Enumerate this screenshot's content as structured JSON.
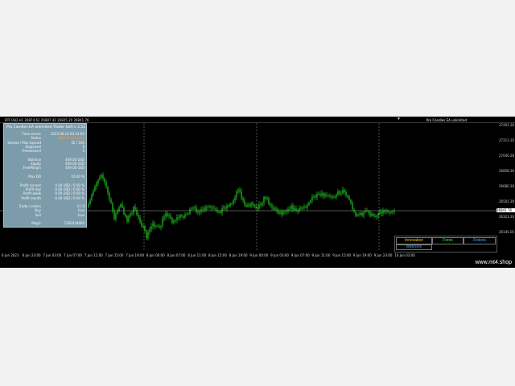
{
  "chart": {
    "symbol_info": "BTCUSD,H1  26874.62 26887.42 26825.20 26841.76",
    "ea_tag": "Pro Candles EA unlimited",
    "drop_marker": "▼",
    "price_ticks": [
      "27403.30",
      "27213.35",
      "27040.28",
      "26858.30",
      "26680.20",
      "26501.30",
      "26323.20",
      "26145.05"
    ],
    "current_price": "26841.76",
    "time_labels": [
      "6 Jun 2023",
      "6 Jun 23:00",
      "7 Jun 03:00",
      "7 Jun 07:00",
      "7 Jun 11:00",
      "7 Jun 15:00",
      "7 Jun 19:00",
      "8 Jun 00:00",
      "8 Jun 07:00",
      "8 Jun 11:00",
      "8 Jun 15:00",
      "8 Jun 19:00",
      "9 Jun 00:00",
      "9 Jun 03:00",
      "9 Jun 07:00",
      "9 Jun 11:00",
      "9 Jun 15:00",
      "9 Jun 19:00",
      "9 Jun 23:00",
      "10 Jun 03:00"
    ],
    "watermark": "www.mt4.shop",
    "colors": {
      "candle": "#22cc22",
      "background": "#000000",
      "panel": "#7d9cab",
      "warning": "#ff9a30"
    }
  },
  "panel": {
    "title": "Pro Candles EA unlimited Trader Soft v 3.52",
    "rows": [
      {
        "label": "Time server",
        "value": "2023.06.10 03:41:00",
        "warn": false
      },
      {
        "label": "Status",
        "value": "Market is closed",
        "warn": true
      },
      {
        "label": "Spread / Max Spread",
        "value": "35 / 100",
        "warn": false
      },
      {
        "label": "StopLevel",
        "value": "0",
        "warn": false
      },
      {
        "label": "FreezeLevel",
        "value": "0",
        "warn": false
      },
      {
        "label": "",
        "value": "",
        "warn": false
      },
      {
        "label": "Balance",
        "value": "449.00 USD",
        "warn": false
      },
      {
        "label": "Equity",
        "value": "449.00 USD",
        "warn": false
      },
      {
        "label": "FreeMargin",
        "value": "449.00 USD",
        "warn": false
      },
      {
        "label": "",
        "value": "",
        "warn": false
      },
      {
        "label": "Max DD",
        "value": "10.00 %",
        "warn": false
      },
      {
        "label": "",
        "value": "",
        "warn": false
      },
      {
        "label": "Profit current",
        "value": "0.00 USD / 0.00 %",
        "warn": false
      },
      {
        "label": "Profit day",
        "value": "0.00 USD / 0.00 %",
        "warn": false
      },
      {
        "label": "Profit week",
        "value": "0.00 USD / 0.00 %",
        "warn": false
      },
      {
        "label": "Profit month",
        "value": "0.00 USD / 0.00 %",
        "warn": false
      },
      {
        "label": "",
        "value": "",
        "warn": false
      },
      {
        "label": "Trade / orders",
        "value": "0 / 0",
        "warn": false
      },
      {
        "label": "Buy",
        "value": "true",
        "warn": false
      },
      {
        "label": "Sell",
        "value": "true",
        "warn": false
      },
      {
        "label": "",
        "value": "",
        "warn": false
      },
      {
        "label": "Magic",
        "value": "7302034466",
        "warn": false
      }
    ]
  },
  "ad": {
    "tabs": [
      {
        "label": "Innovation",
        "color": "#ffcc00"
      },
      {
        "label": "Forex",
        "color": "#33ff33"
      },
      {
        "label": "Robots",
        "color": "#33aaff"
      }
    ],
    "link": "website"
  }
}
